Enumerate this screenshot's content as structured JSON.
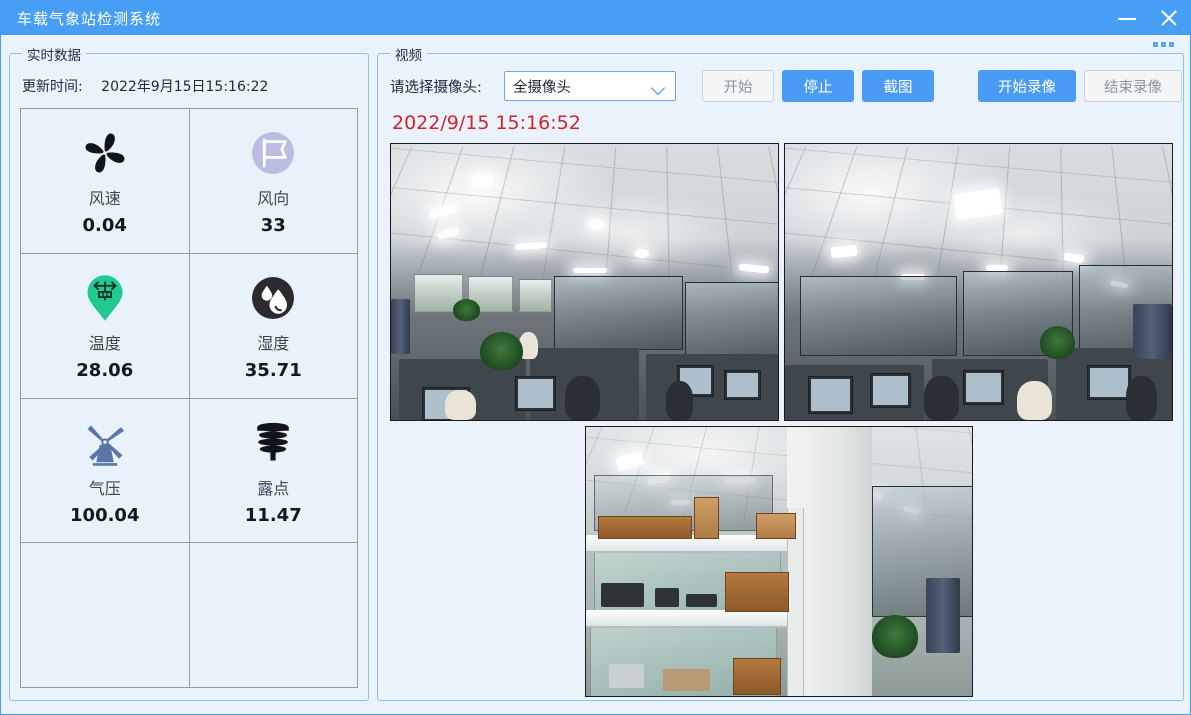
{
  "window": {
    "title": "车载气象站检测系统",
    "accent_color": "#479ef5",
    "background_color": "#eaf2fc",
    "controls": {
      "minimize": "minimize-icon",
      "close": "close-icon",
      "grip": "three-dots-icon"
    }
  },
  "left_panel": {
    "group_title": "实时数据",
    "update": {
      "label": "更新时间:",
      "value": "2022年9月15日15:16:22"
    },
    "metrics": [
      {
        "icon": "fan-icon",
        "name": "风速",
        "value": "0.04",
        "color": "#111418"
      },
      {
        "icon": "flag-icon",
        "name": "风向",
        "value": "33",
        "color": "#b9bde2"
      },
      {
        "icon": "thermometer-pin-icon",
        "name": "温度",
        "value": "28.06",
        "color": "#1fc98f"
      },
      {
        "icon": "humidity-drop-icon",
        "name": "湿度",
        "value": "35.71",
        "color": "#2b2b2f"
      },
      {
        "icon": "windmill-icon",
        "name": "气压",
        "value": "100.04",
        "color": "#5a76a8"
      },
      {
        "icon": "dewpoint-sensor-icon",
        "name": "露点",
        "value": "11.47",
        "color": "#111418"
      },
      {
        "icon": "",
        "name": "",
        "value": ""
      },
      {
        "icon": "",
        "name": "",
        "value": ""
      }
    ]
  },
  "right_panel": {
    "group_title": "视频",
    "camera_select": {
      "label": "请选择摄像头:",
      "value": "全摄像头",
      "chevron": "chevron-down-icon"
    },
    "buttons": [
      {
        "id": "start",
        "label": "开始",
        "style": "plain"
      },
      {
        "id": "stop",
        "label": "停止",
        "style": "primary"
      },
      {
        "id": "screenshot",
        "label": "截图",
        "style": "primary"
      },
      {
        "id": "rec_start",
        "label": "开始录像",
        "style": "primary"
      },
      {
        "id": "rec_stop",
        "label": "结束录像",
        "style": "plain"
      }
    ],
    "timestamp": "2022/9/15 15:16:52",
    "timestamp_color": "#d2232a",
    "video_feeds": [
      {
        "id": "cam-1",
        "scene": "office-wide-angle"
      },
      {
        "id": "cam-2",
        "scene": "office-glass-partition"
      },
      {
        "id": "cam-3",
        "scene": "storage-shelving-room"
      }
    ]
  }
}
